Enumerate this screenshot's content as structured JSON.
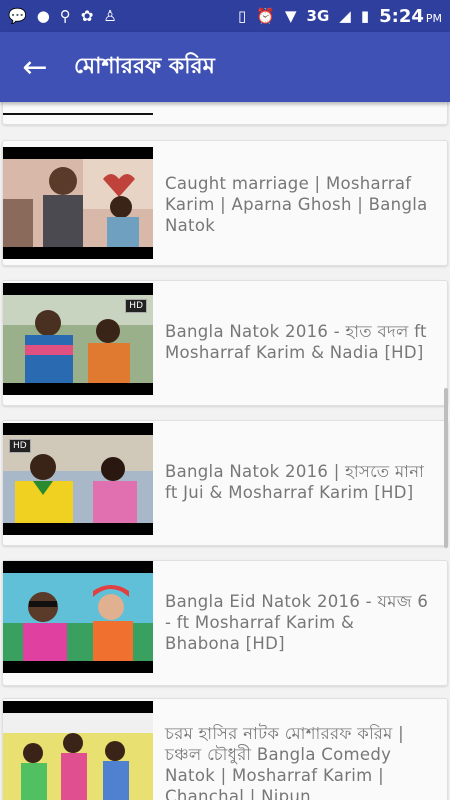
{
  "status_bar": {
    "time": "5:24",
    "ampm": "PM",
    "network": "3G",
    "icons": [
      "message-icon",
      "circle-icon",
      "usb-icon",
      "flower-icon",
      "android-icon",
      "vibrate-icon",
      "alarm-icon",
      "wifi-icon",
      "signal-icon",
      "battery-icon"
    ]
  },
  "app_bar": {
    "title": "মোশাররফ করিম"
  },
  "videos": [
    {
      "title": "Caught marriage | Mosharraf Karim | Aparna Ghosh | Bangla Natok",
      "badge": ""
    },
    {
      "title": "Bangla Natok 2016 - হাত বদল ft Mosharraf Karim & Nadia [HD]",
      "badge": "HD"
    },
    {
      "title": "Bangla Natok 2016 | হাসতে মানা ft Jui & Mosharraf Karim [HD]",
      "badge": "HD"
    },
    {
      "title": "Bangla Eid Natok 2016 - যমজ 6 - ft Mosharraf Karim & Bhabona [HD]",
      "badge": ""
    },
    {
      "title": "চরম হাসির নাটক মোশাররফ করিম | চঞ্চল চৌধুরী Bangla Comedy Natok | Mosharraf Karim | Chanchal | Nipun",
      "badge": ""
    }
  ],
  "colors": {
    "primary": "#3f51b5",
    "status": "#2f3f9e",
    "card": "#fafafa",
    "caption": "#777777"
  }
}
